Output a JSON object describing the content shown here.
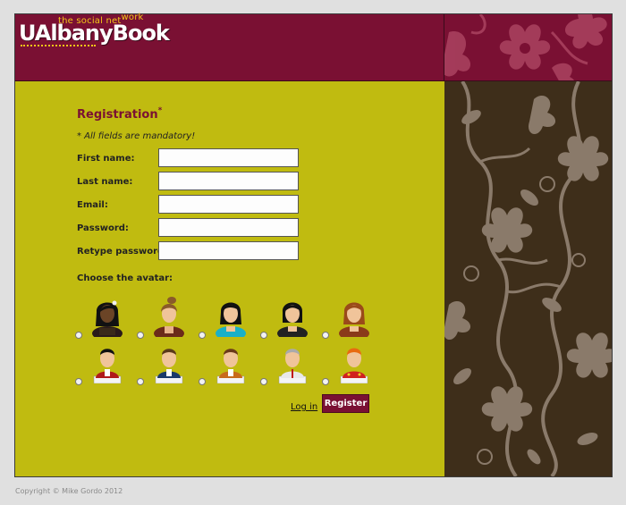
{
  "brand": {
    "name": "UAlbanyBook",
    "tagline_main": "the social net",
    "tagline_sup": "work"
  },
  "form": {
    "title": "Registration",
    "title_marker": "*",
    "note": "* All fields are mandatory!",
    "fields": [
      {
        "label": "First name:",
        "value": ""
      },
      {
        "label": "Last name:",
        "value": ""
      },
      {
        "label": "Email:",
        "value": ""
      },
      {
        "label": "Password:",
        "value": ""
      },
      {
        "label": "Retype password:",
        "value": ""
      }
    ],
    "avatar_prompt": "Choose the avatar:",
    "avatars": [
      {
        "icon": "avatar-woman-dark-skin-icon"
      },
      {
        "icon": "avatar-woman-ponytail-icon"
      },
      {
        "icon": "avatar-woman-teal-top-icon"
      },
      {
        "icon": "avatar-woman-black-hair-icon"
      },
      {
        "icon": "avatar-woman-auburn-icon"
      },
      {
        "icon": "avatar-man-red-suit-icon"
      },
      {
        "icon": "avatar-man-blue-suit-icon"
      },
      {
        "icon": "avatar-man-orange-vest-icon"
      },
      {
        "icon": "avatar-man-gray-hair-icon"
      },
      {
        "icon": "avatar-man-red-hair-icon"
      }
    ],
    "login_label": "Log in",
    "register_label": "Register"
  },
  "footer": {
    "copyright": "Copyright © Mike Gordo 2012"
  },
  "colors": {
    "brand_maroon": "#7a1033",
    "form_background": "#c0bb10",
    "tagline_yellow": "#f1c618",
    "decor_dark": "#3e2e1a",
    "page_background": "#e0e0e0"
  }
}
